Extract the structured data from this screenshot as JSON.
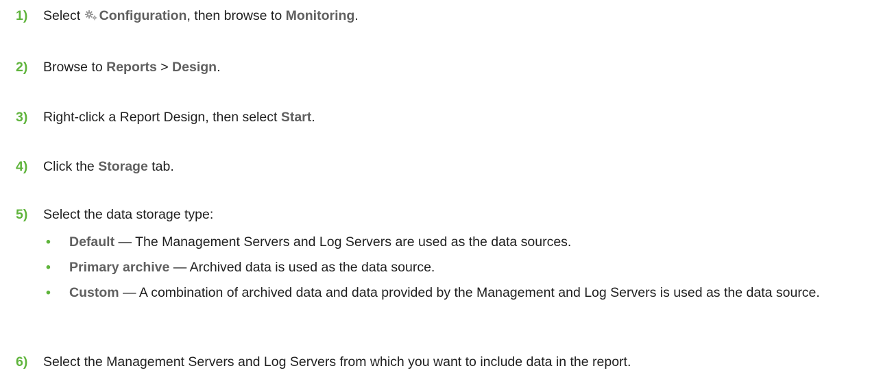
{
  "steps": [
    {
      "num": "1)",
      "p1": "Select ",
      "icon": "gear-icon",
      "b1": "Configuration",
      "p2": ", then browse to ",
      "b2": "Monitoring",
      "p3": "."
    },
    {
      "num": "2)",
      "p1": "Browse to ",
      "b1": "Reports",
      "p2": " > ",
      "b2": "Design",
      "p3": "."
    },
    {
      "num": "3)",
      "p1": "Right-click a Report Design, then select ",
      "b1": "Start",
      "p2": "."
    },
    {
      "num": "4)",
      "p1": "Click the ",
      "b1": "Storage",
      "p2": " tab."
    },
    {
      "num": "5)",
      "p1": "Select the data storage type:",
      "bullets": [
        {
          "term": "Default",
          "desc": " — The Management Servers and Log Servers are used as the data sources."
        },
        {
          "term": "Primary archive",
          "desc": " — Archived data is used as the data source."
        },
        {
          "term": "Custom",
          "desc": " — A combination of archived data and data provided by the Management and Log Servers is used as the data source."
        }
      ]
    },
    {
      "num": "6)",
      "p1": "Select the Management Servers and Log Servers from which you want to include data in the report."
    }
  ],
  "colors": {
    "accent": "#5fb43c",
    "bold_text": "#606060",
    "body_text": "#1f1f1f"
  }
}
